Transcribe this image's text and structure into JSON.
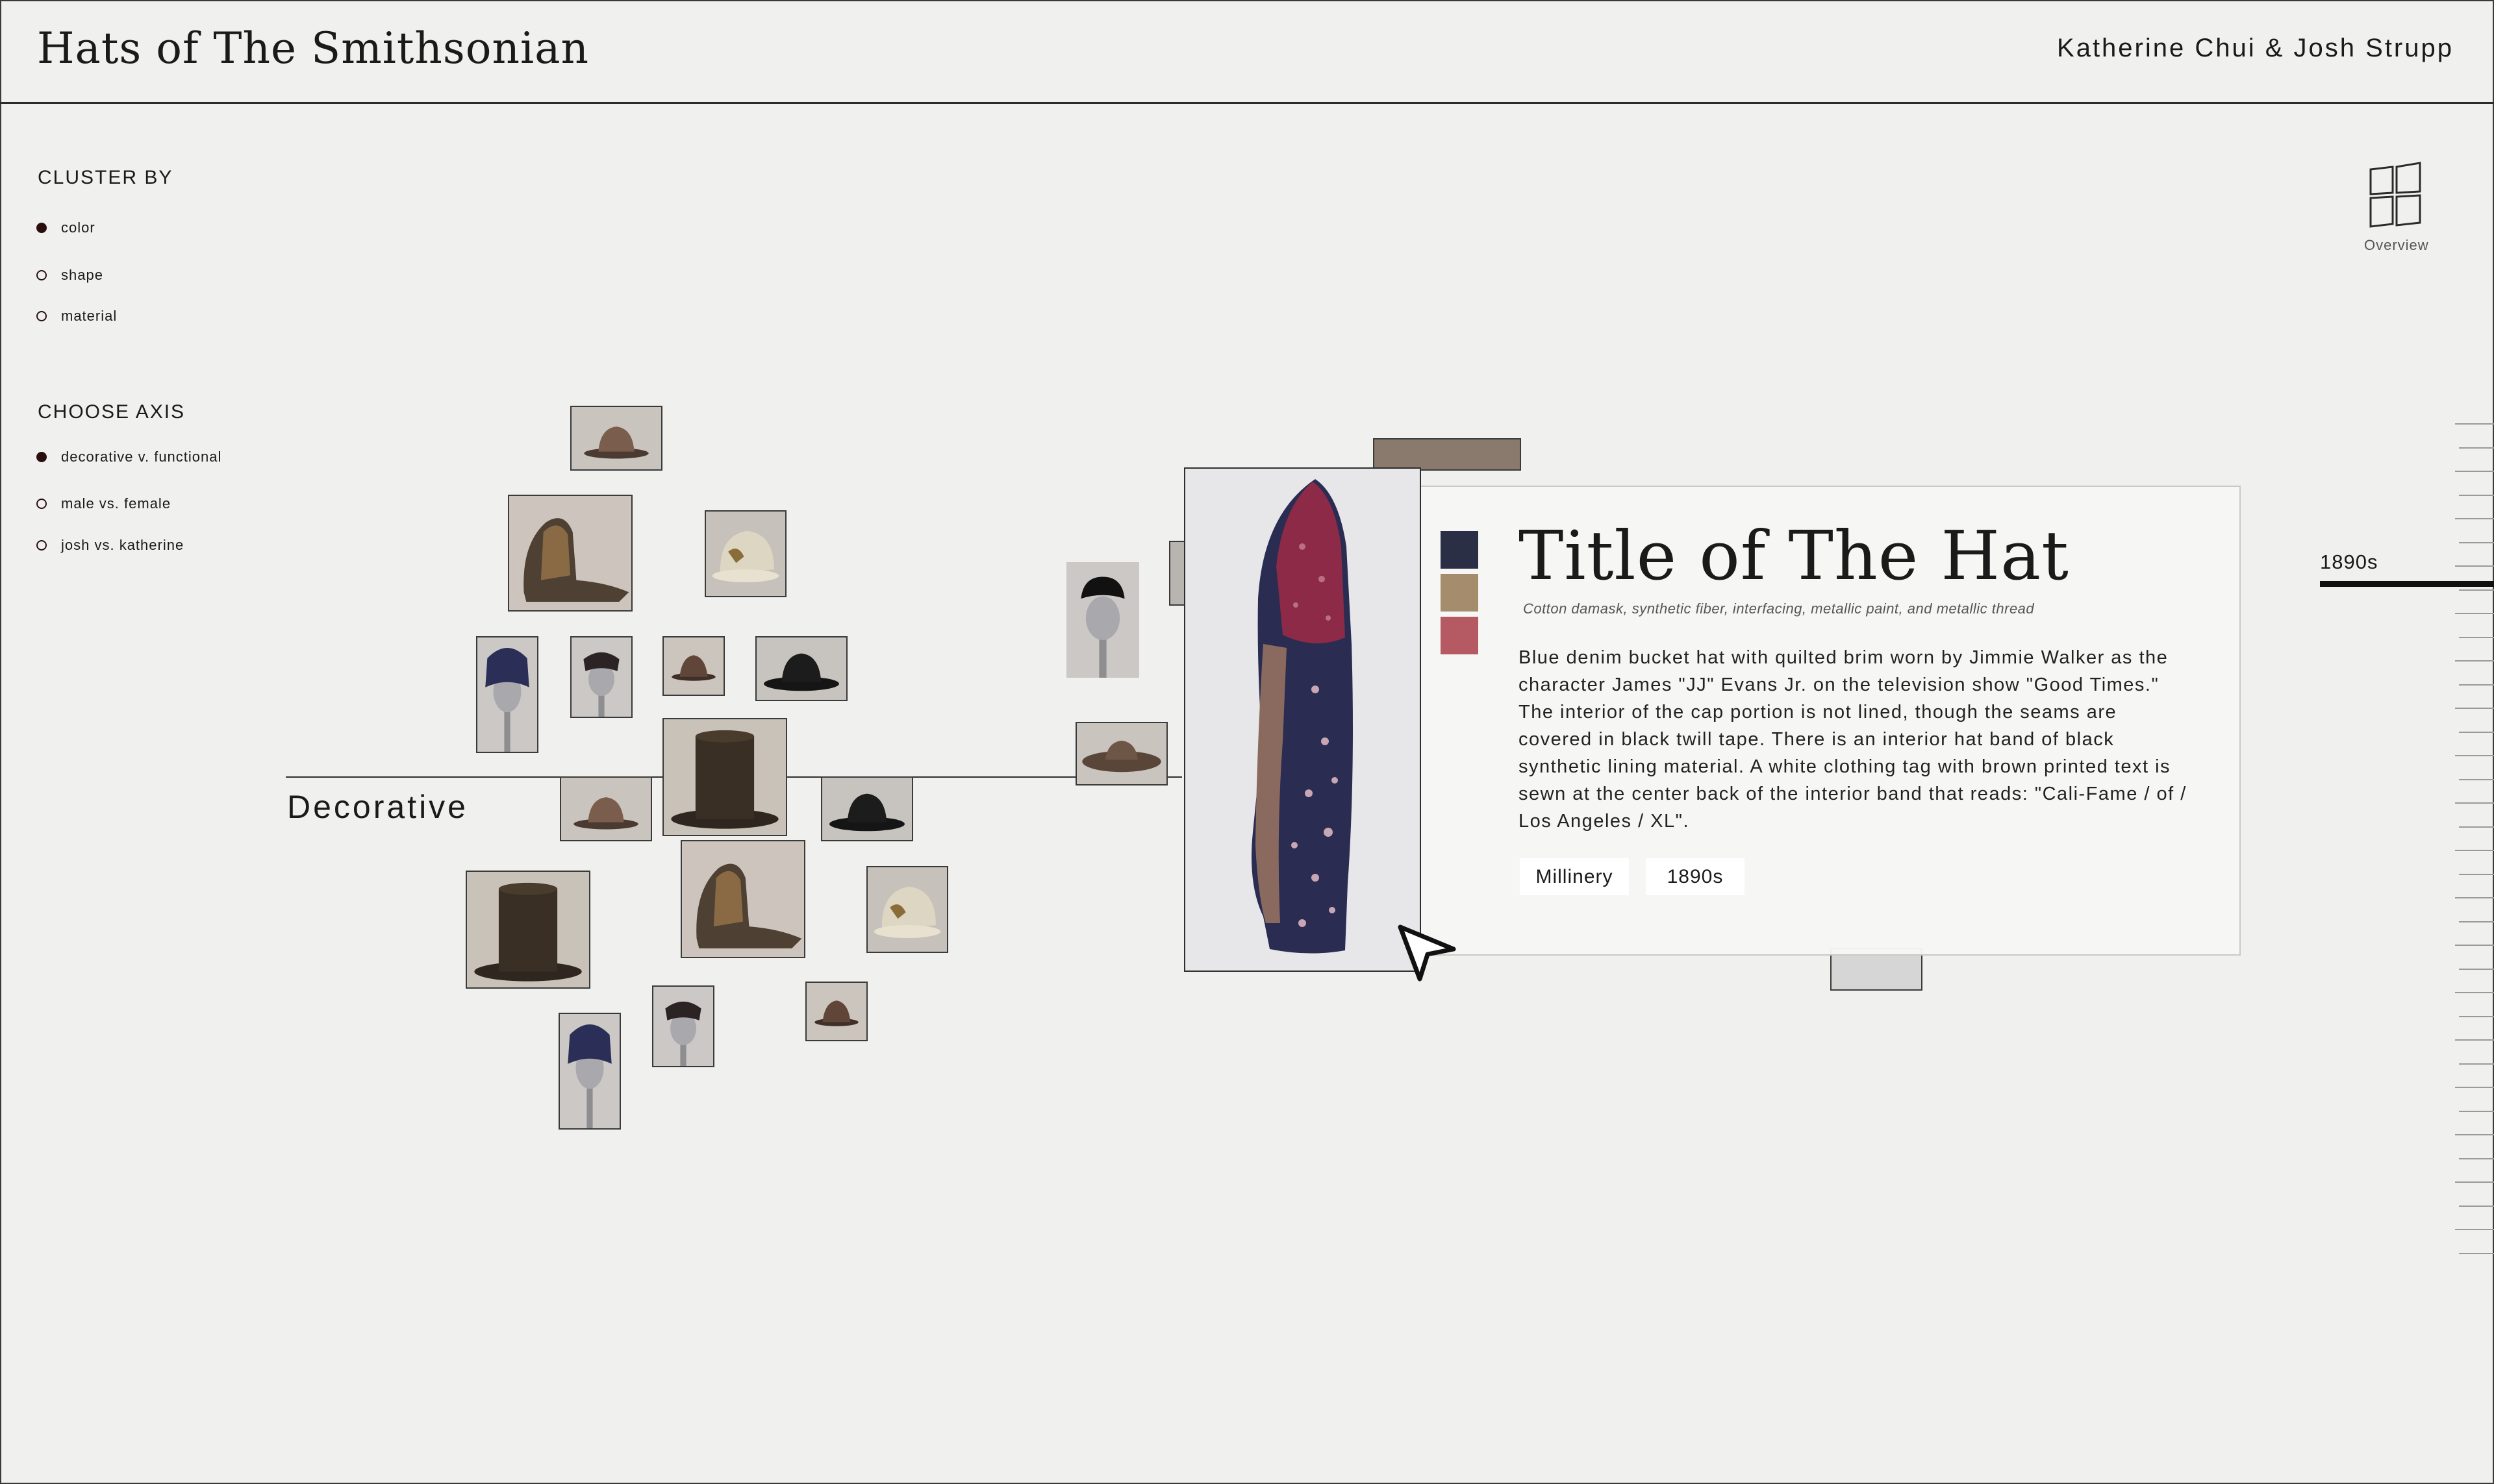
{
  "header": {
    "title": "Hats of The Smithsonian",
    "authors": "Katherine Chui & Josh Strupp"
  },
  "cluster_by": {
    "title": "CLUSTER BY",
    "options": [
      {
        "label": "color",
        "selected": true
      },
      {
        "label": "shape",
        "selected": false
      },
      {
        "label": "material",
        "selected": false
      }
    ]
  },
  "choose_axis": {
    "title": "CHOOSE AXIS",
    "options": [
      {
        "label": "decorative v. functional",
        "selected": true
      },
      {
        "label": "male vs. female",
        "selected": false
      },
      {
        "label": "josh vs. katherine",
        "selected": false
      }
    ]
  },
  "overview": {
    "label": "Overview",
    "icon": "grid-icon"
  },
  "axis": {
    "label": "Decorative"
  },
  "detail": {
    "title": "Title of The Hat",
    "materials": "Cotton damask, synthetic fiber, interfacing, metallic paint, and metallic thread",
    "description": "Blue denim bucket hat with quilted brim worn by Jimmie Walker as the character James \"JJ\" Evans Jr. on the television show \"Good Times.\" The interior of the cap portion is not lined, though the seams are covered in black twill tape. There is an interior hat band of black synthetic lining material. A white clothing tag with brown printed text is sewn at the center back of the interior band that reads: \"Cali-Fame / of / Los Angeles / XL\".",
    "tags": [
      "Millinery",
      "1890s"
    ],
    "swatches": [
      "#2a2f45",
      "#a48c6c",
      "#b55a63"
    ]
  },
  "timeline": {
    "selected_year": "1890s"
  },
  "colors": {
    "background": "#f0f0ee",
    "selected_radio": "#2a0e0e"
  }
}
